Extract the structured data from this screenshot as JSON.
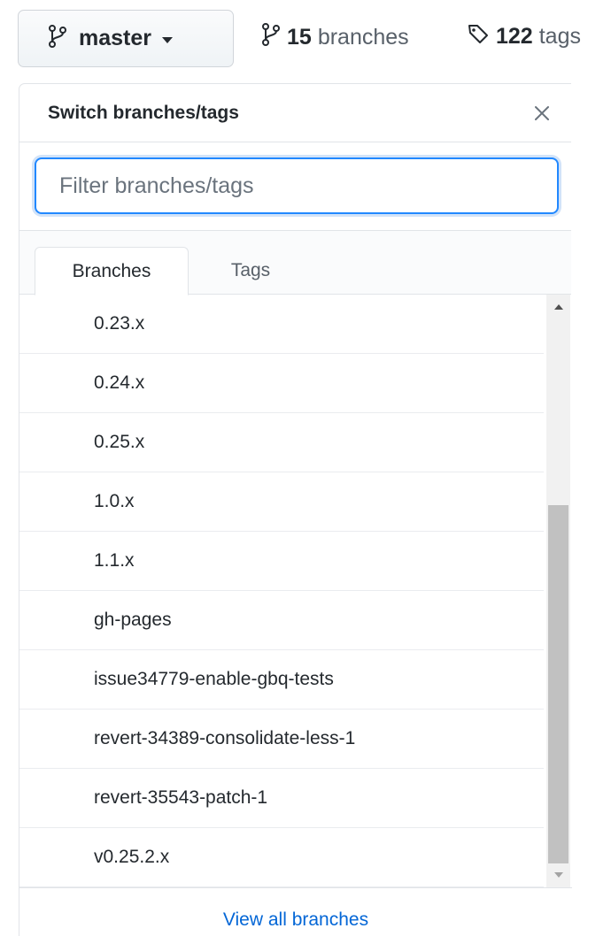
{
  "topbar": {
    "branch_button": {
      "icon": "git-branch-icon",
      "label": "master",
      "caret": "caret-down-icon"
    },
    "branches_stat": {
      "icon": "git-branch-icon",
      "count": "15",
      "word": "branches"
    },
    "tags_stat": {
      "icon": "tag-icon",
      "count": "122",
      "word": "tags"
    }
  },
  "dropdown": {
    "title": "Switch branches/tags",
    "close_icon": "close-icon",
    "filter": {
      "placeholder": "Filter branches/tags",
      "value": ""
    },
    "tabs": [
      {
        "label": "Branches",
        "selected": true
      },
      {
        "label": "Tags",
        "selected": false
      }
    ],
    "branches": [
      {
        "label": "0.23.x"
      },
      {
        "label": "0.24.x"
      },
      {
        "label": "0.25.x"
      },
      {
        "label": "1.0.x"
      },
      {
        "label": "1.1.x"
      },
      {
        "label": "gh-pages"
      },
      {
        "label": "issue34779-enable-gbq-tests"
      },
      {
        "label": "revert-34389-consolidate-less-1"
      },
      {
        "label": "revert-35543-patch-1"
      },
      {
        "label": "v0.25.2.x"
      }
    ],
    "footer_link": "View all branches"
  },
  "colors": {
    "accent_blue": "#0366d6",
    "focus_border": "#2188ff",
    "text": "#24292e",
    "muted": "#586069"
  }
}
